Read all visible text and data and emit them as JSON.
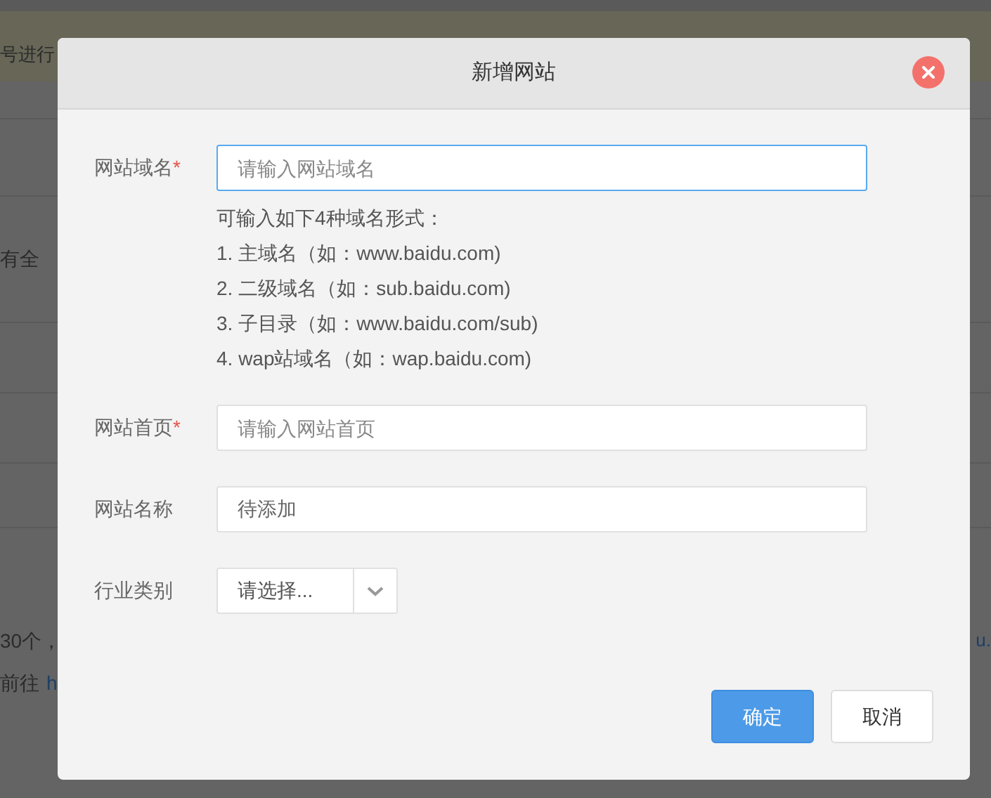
{
  "background_page": {
    "notice_text": "号进行",
    "row_text": "有全",
    "footer_lines": [
      {
        "text": "30个，",
        "link": "u."
      },
      {
        "text": "前往",
        "link": "h"
      }
    ]
  },
  "dialog": {
    "title": "新增网站",
    "fields": [
      {
        "kind": "input",
        "label": "网站域名",
        "required_mark": "*",
        "placeholder": "请输入网站域名",
        "focused": true,
        "help": {
          "intro": "可输入如下4种域名形式：",
          "items": [
            "1. 主域名（如：www.baidu.com)",
            "2. 二级域名（如：sub.baidu.com)",
            "3. 子目录（如：www.baidu.com/sub)",
            "4. wap站域名（如：wap.baidu.com)"
          ]
        }
      },
      {
        "kind": "input",
        "label": "网站首页",
        "required_mark": "*",
        "placeholder": "请输入网站首页",
        "focused": false
      },
      {
        "kind": "input",
        "label": "网站名称",
        "value": "待添加",
        "focused": false
      },
      {
        "kind": "select",
        "label": "行业类别",
        "value": "请选择..."
      }
    ],
    "buttons": [
      {
        "label": "确定",
        "primary": true
      },
      {
        "label": "取消",
        "primary": false
      }
    ]
  }
}
